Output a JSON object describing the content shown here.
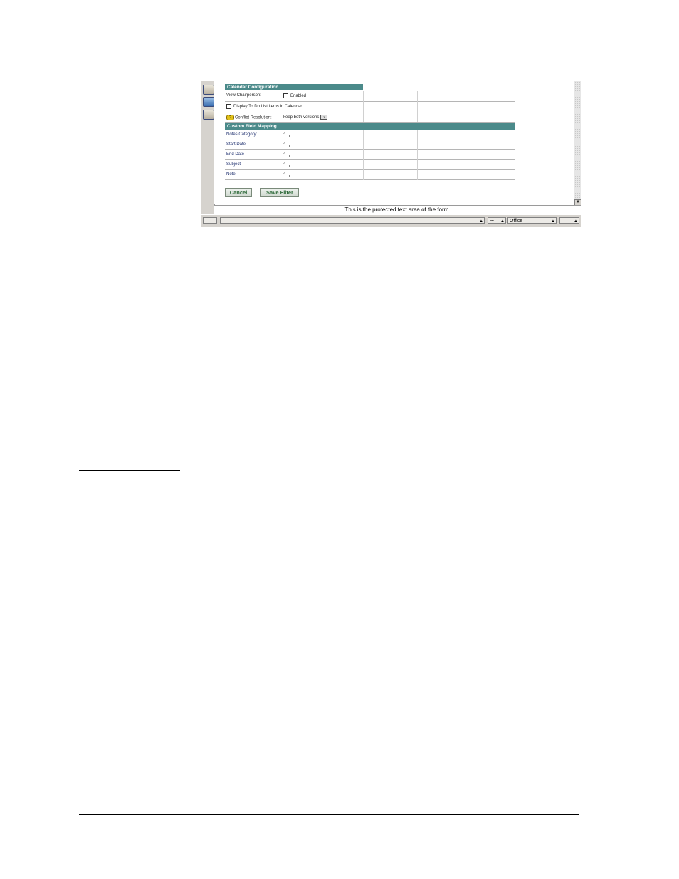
{
  "form": {
    "calendar_config_header": "Calendar Configuration",
    "view_chairperson_label": "View Chairperson:",
    "view_chairperson_checkbox_label": "Enabled",
    "display_todo_label": "Display To Do List items in Calendar",
    "conflict_resolution_label": "Conflict Resolution:",
    "conflict_resolution_value": "keep both versions",
    "custom_mapping_header": "Custom Field Mapping",
    "mapping_fields": [
      "Notes Category:",
      "Start Date",
      "End Date",
      "Subject",
      "Note"
    ],
    "cancel_label": "Cancel",
    "save_filter_label": "Save Filter"
  },
  "footer": {
    "protected_text": "This is the protected text area of the form."
  },
  "statusbar": {
    "location_value": "Office"
  },
  "colors": {
    "section_header": "#4b8a8a",
    "button_text": "#2e6a3a"
  }
}
